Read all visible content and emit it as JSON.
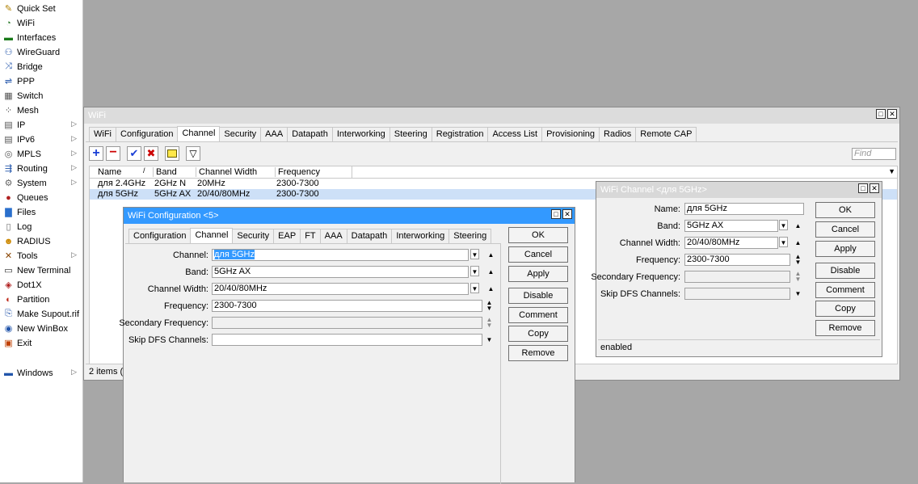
{
  "sidebar": {
    "items": [
      {
        "label": "Quick Set",
        "icon": "quick-set-icon",
        "arrow": false
      },
      {
        "label": "WiFi",
        "icon": "wifi-icon",
        "arrow": false
      },
      {
        "label": "Interfaces",
        "icon": "interfaces-icon",
        "arrow": false
      },
      {
        "label": "WireGuard",
        "icon": "wireguard-icon",
        "arrow": false
      },
      {
        "label": "Bridge",
        "icon": "bridge-icon",
        "arrow": false
      },
      {
        "label": "PPP",
        "icon": "ppp-icon",
        "arrow": false
      },
      {
        "label": "Switch",
        "icon": "switch-icon",
        "arrow": false
      },
      {
        "label": "Mesh",
        "icon": "mesh-icon",
        "arrow": false
      },
      {
        "label": "IP",
        "icon": "ip-icon",
        "arrow": true
      },
      {
        "label": "IPv6",
        "icon": "ipv6-icon",
        "arrow": true
      },
      {
        "label": "MPLS",
        "icon": "mpls-icon",
        "arrow": true
      },
      {
        "label": "Routing",
        "icon": "routing-icon",
        "arrow": true
      },
      {
        "label": "System",
        "icon": "system-icon",
        "arrow": true
      },
      {
        "label": "Queues",
        "icon": "queues-icon",
        "arrow": false
      },
      {
        "label": "Files",
        "icon": "files-icon",
        "arrow": false
      },
      {
        "label": "Log",
        "icon": "log-icon",
        "arrow": false
      },
      {
        "label": "RADIUS",
        "icon": "radius-icon",
        "arrow": false
      },
      {
        "label": "Tools",
        "icon": "tools-icon",
        "arrow": true
      },
      {
        "label": "New Terminal",
        "icon": "terminal-icon",
        "arrow": false
      },
      {
        "label": "Dot1X",
        "icon": "dot1x-icon",
        "arrow": false
      },
      {
        "label": "Partition",
        "icon": "partition-icon",
        "arrow": false
      },
      {
        "label": "Make Supout.rif",
        "icon": "supout-icon",
        "arrow": false
      },
      {
        "label": "New WinBox",
        "icon": "winbox-icon",
        "arrow": false
      },
      {
        "label": "Exit",
        "icon": "exit-icon",
        "arrow": false
      }
    ],
    "windows": {
      "label": "Windows",
      "icon": "windows-icon",
      "arrow": true
    }
  },
  "wifi_window": {
    "title": "WiFi",
    "tabs": [
      "WiFi",
      "Configuration",
      "Channel",
      "Security",
      "AAA",
      "Datapath",
      "Interworking",
      "Steering",
      "Registration",
      "Access List",
      "Provisioning",
      "Radios",
      "Remote CAP"
    ],
    "active_tab": "Channel",
    "find_placeholder": "Find",
    "columns": [
      "Name",
      "Band",
      "Channel Width",
      "Frequency"
    ],
    "rows": [
      {
        "name": "для 2.4GHz",
        "band": "2GHz N",
        "width": "20MHz",
        "freq": "2300-7300",
        "selected": false
      },
      {
        "name": "для 5GHz",
        "band": "5GHz AX",
        "width": "20/40/80MHz",
        "freq": "2300-7300",
        "selected": true
      }
    ],
    "status": "2 items (1"
  },
  "config_window": {
    "title": "WiFi Configuration <5>",
    "tabs": [
      "Configuration",
      "Channel",
      "Security",
      "EAP",
      "FT",
      "AAA",
      "Datapath",
      "Interworking",
      "Steering"
    ],
    "active_tab": "Channel",
    "fields": {
      "channel_label": "Channel:",
      "channel_value": "для 5GHz",
      "band_label": "Band:",
      "band_value": "5GHz AX",
      "width_label": "Channel Width:",
      "width_value": "20/40/80MHz",
      "freq_label": "Frequency:",
      "freq_value": "2300-7300",
      "secfreq_label": "Secondary Frequency:",
      "secfreq_value": "",
      "dfs_label": "Skip DFS Channels:",
      "dfs_value": ""
    },
    "buttons": {
      "ok": "OK",
      "cancel": "Cancel",
      "apply": "Apply",
      "disable": "Disable",
      "comment": "Comment",
      "copy": "Copy",
      "remove": "Remove"
    }
  },
  "channel_window": {
    "title": "WiFi Channel <для 5GHz>",
    "fields": {
      "name_label": "Name:",
      "name_value": "для 5GHz",
      "band_label": "Band:",
      "band_value": "5GHz AX",
      "width_label": "Channel Width:",
      "width_value": "20/40/80MHz",
      "freq_label": "Frequency:",
      "freq_value": "2300-7300",
      "secfreq_label": "Secondary Frequency:",
      "secfreq_value": "",
      "dfs_label": "Skip DFS Channels:",
      "dfs_value": ""
    },
    "buttons": {
      "ok": "OK",
      "cancel": "Cancel",
      "apply": "Apply",
      "disable": "Disable",
      "comment": "Comment",
      "copy": "Copy",
      "remove": "Remove"
    },
    "status": "enabled"
  },
  "colors": {
    "selection": "#3399ff",
    "row_selected": "#cde0f7",
    "background": "#a7a7a7"
  }
}
